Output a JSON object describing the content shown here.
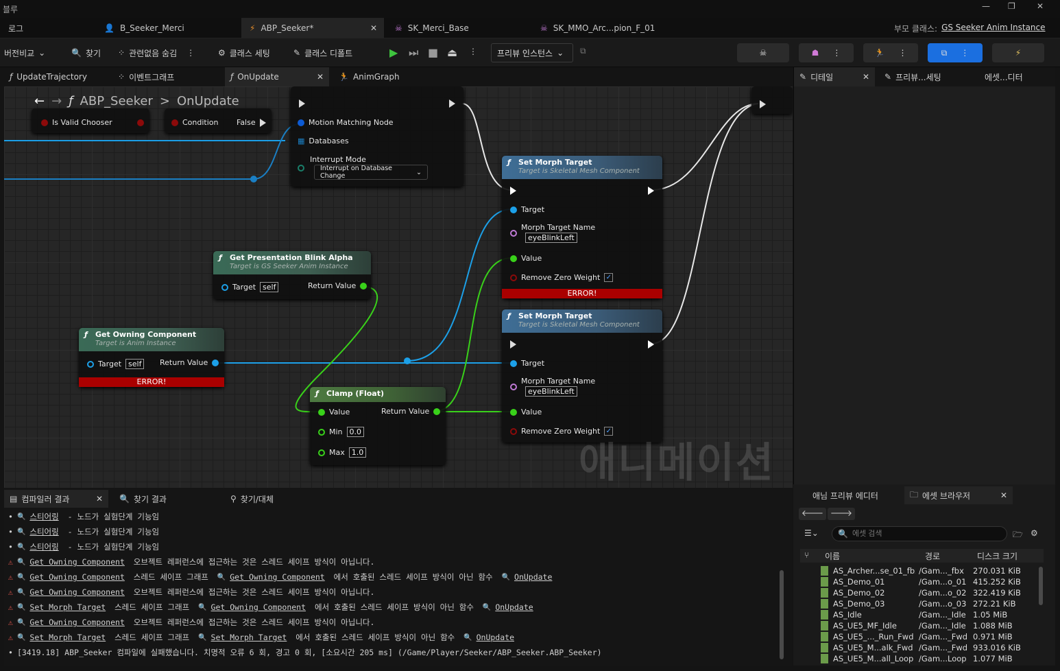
{
  "titlebar": {
    "title_partial": "블루"
  },
  "doc_tabs": [
    {
      "label": "로그"
    },
    {
      "label": "B_Seeker_Merci"
    },
    {
      "label": "ABP_Seeker*"
    },
    {
      "label": "SK_Merci_Base"
    },
    {
      "label": "SK_MMO_Arc...pion_F_01"
    }
  ],
  "parent_class": {
    "label": "부모 클래스:",
    "value": "GS Seeker Anim Instance"
  },
  "toolbar": {
    "diff": "버전비교",
    "find": "찾기",
    "hide_unrelated": "관련없음 숨김",
    "class_settings": "클래스 세팅",
    "class_defaults": "클래스 디폴트",
    "preview_instance": "프리뷰 인스턴스"
  },
  "graph_tabs": [
    {
      "label": "UpdateTrajectory"
    },
    {
      "label": "이벤트그래프"
    },
    {
      "label": "OnUpdate"
    },
    {
      "label": "AnimGraph"
    }
  ],
  "breadcrumb": {
    "root": "ABP_Seeker",
    "sep": ">",
    "leaf": "OnUpdate"
  },
  "nodes": {
    "is_valid": {
      "pin": "Is Valid Chooser"
    },
    "branch": {
      "cond": "Condition",
      "false": "False"
    },
    "motion": {
      "pin1": "Motion Matching Node",
      "pin2": "Databases",
      "pin3": "Interrupt Mode",
      "combo": "Interrupt on Database Change"
    },
    "morph1": {
      "title": "Set Morph Target",
      "sub": "Target is Skeletal Mesh Component",
      "target": "Target",
      "name_label": "Morph Target Name",
      "name_value": "eyeBlinkLeft",
      "value": "Value",
      "rzw": "Remove Zero Weight",
      "error": "ERROR!"
    },
    "morph2": {
      "title": "Set Morph Target",
      "sub": "Target is Skeletal Mesh Component",
      "target": "Target",
      "name_label": "Morph Target Name",
      "name_value": "eyeBlinkLeft",
      "value": "Value",
      "rzw": "Remove Zero Weight"
    },
    "blink": {
      "title": "Get Presentation Blink Alpha",
      "sub": "Target is GS Seeker Anim Instance",
      "target": "Target",
      "self": "self",
      "ret": "Return Value"
    },
    "owning": {
      "title": "Get Owning Component",
      "sub": "Target is Anim Instance",
      "target": "Target",
      "self": "self",
      "ret": "Return Value",
      "error": "ERROR!"
    },
    "clamp": {
      "title": "Clamp (Float)",
      "value": "Value",
      "ret": "Return Value",
      "min": "Min",
      "min_v": "0.0",
      "max": "Max",
      "max_v": "1.0"
    }
  },
  "watermark": "애니메이션",
  "details_tabs": [
    {
      "label": "디테일"
    },
    {
      "label": "프리뷰...세팅"
    },
    {
      "label": "에셋...디터"
    }
  ],
  "bottom_tabs": [
    {
      "label": "컴파일러 결과"
    },
    {
      "label": "찾기 결과"
    },
    {
      "label": "찾기/대체"
    }
  ],
  "log": [
    {
      "kind": "bullet",
      "parts": [
        {
          "t": "스티어링",
          "link": true
        },
        {
          "t": " - 노드가 실험단계 기능임"
        }
      ]
    },
    {
      "kind": "bullet",
      "parts": [
        {
          "t": "스티어링",
          "link": true
        },
        {
          "t": " - 노드가 실험단계 기능임"
        }
      ]
    },
    {
      "kind": "bullet",
      "parts": [
        {
          "t": "스티어링",
          "link": true
        },
        {
          "t": " - 노드가 실험단계 기능임"
        }
      ]
    },
    {
      "kind": "warn",
      "parts": [
        {
          "t": "Get Owning Component",
          "link": true
        },
        {
          "t": " 오브젝트 레퍼런스에 접근하는 것은 스레드 세이프 방식이 아닙니다."
        }
      ]
    },
    {
      "kind": "warn",
      "parts": [
        {
          "t": "Get Owning Component",
          "link": true
        },
        {
          "t": " 스레드 세이프 그래프 "
        },
        {
          "t": "Get Owning Component",
          "link": true
        },
        {
          "t": " 에서 호출된 스레드 세이프 방식이 아닌 함수 "
        },
        {
          "t": "OnUpdate",
          "link": true
        }
      ]
    },
    {
      "kind": "warn",
      "parts": [
        {
          "t": "Get Owning Component",
          "link": true
        },
        {
          "t": " 오브젝트 레퍼런스에 접근하는 것은 스레드 세이프 방식이 아닙니다."
        }
      ]
    },
    {
      "kind": "warn",
      "parts": [
        {
          "t": "Set Morph Target",
          "link": true
        },
        {
          "t": " 스레드 세이프 그래프 "
        },
        {
          "t": "Get Owning Component",
          "link": true
        },
        {
          "t": " 에서 호출된 스레드 세이프 방식이 아닌 함수 "
        },
        {
          "t": "OnUpdate",
          "link": true
        }
      ]
    },
    {
      "kind": "warn",
      "parts": [
        {
          "t": "Get Owning Component",
          "link": true
        },
        {
          "t": " 오브젝트 레퍼런스에 접근하는 것은 스레드 세이프 방식이 아닙니다."
        }
      ]
    },
    {
      "kind": "warn",
      "parts": [
        {
          "t": "Set Morph Target",
          "link": true
        },
        {
          "t": " 스레드 세이프 그래프 "
        },
        {
          "t": "Set Morph Target",
          "link": true
        },
        {
          "t": " 에서 호출된 스레드 세이프 방식이 아닌 함수 "
        },
        {
          "t": "OnUpdate",
          "link": true
        }
      ]
    },
    {
      "kind": "plain",
      "parts": [
        {
          "t": "[3419.18] ABP_Seeker 컴파일에 실패했습니다. 치명적 오류 6 회, 경고 0 회, [소요시간 205 ms] (/Game/Player/Seeker/ABP_Seeker.ABP_Seeker)"
        }
      ]
    }
  ],
  "asset_panel": {
    "tabs": [
      {
        "label": "애님 프리뷰 에디터"
      },
      {
        "label": "에셋 브라우저"
      }
    ],
    "search_placeholder": "에셋 검색",
    "columns": [
      "이름",
      "경로",
      "디스크 크기"
    ],
    "rows": [
      [
        "AS_Archer...se_01_fbx",
        "/Gam..._fbx",
        "270.031 KiB"
      ],
      [
        "AS_Demo_01",
        "/Gam...o_01",
        "415.252 KiB"
      ],
      [
        "AS_Demo_02",
        "/Gam...o_02",
        "322.419 KiB"
      ],
      [
        "AS_Demo_03",
        "/Gam...o_03",
        "272.21 KiB"
      ],
      [
        "AS_Idle",
        "/Gam..._Idle",
        "1.05 MiB"
      ],
      [
        "AS_UE5_MF_Idle",
        "/Gam..._Idle",
        "1.088 MiB"
      ],
      [
        "AS_UE5_..._Run_Fwd",
        "/Gam..._Fwd",
        "0.971 MiB"
      ],
      [
        "AS_UE5_M...alk_Fwd",
        "/Gam..._Fwd",
        "933.016 KiB"
      ],
      [
        "AS_UE5_M...all_Loop",
        "/Gam...Loop",
        "1.077 MiB"
      ]
    ]
  },
  "colors": {
    "accent": "#0a6ad8",
    "error": "#a00000",
    "exec": "#ffffff",
    "object_pin": "#1ca0e8",
    "float_pin": "#39d11a",
    "name_pin": "#c07ad6",
    "bool_pin": "#8c0a0a",
    "struct_pin": "#0d5bd4"
  }
}
